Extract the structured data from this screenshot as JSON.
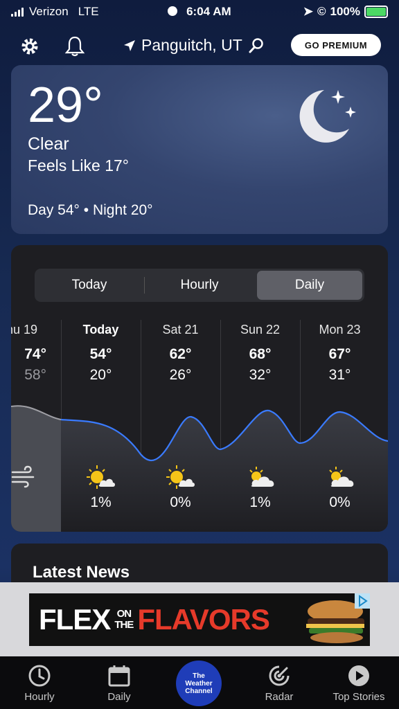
{
  "status_bar": {
    "carrier": "Verizon",
    "network": "LTE",
    "time": "6:04 AM",
    "battery": "100%"
  },
  "header": {
    "location": "Panguitch, UT",
    "premium_label": "GO PREMIUM"
  },
  "current": {
    "temperature": "29°",
    "condition": "Clear",
    "feels_like": "Feels Like 17°",
    "day_night": "Day 54° • Night 20°",
    "icon": "moon-stars-icon"
  },
  "forecast": {
    "tabs": [
      "Today",
      "Hourly",
      "Daily"
    ],
    "active_tab": "Daily",
    "days": [
      {
        "label": "hu 19",
        "high": "74°",
        "low": "58°",
        "precip": "",
        "icon": "wind-icon"
      },
      {
        "label": "Today",
        "high": "54°",
        "low": "20°",
        "precip": "1%",
        "icon": "sunny-cloud-icon"
      },
      {
        "label": "Sat 21",
        "high": "62°",
        "low": "26°",
        "precip": "0%",
        "icon": "sunny-cloud-icon"
      },
      {
        "label": "Sun 22",
        "high": "68°",
        "low": "32°",
        "precip": "1%",
        "icon": "partly-cloudy-icon"
      },
      {
        "label": "Mon 23",
        "high": "67°",
        "low": "31°",
        "precip": "0%",
        "icon": "partly-cloudy-icon"
      }
    ]
  },
  "news": {
    "title": "Latest News"
  },
  "ad": {
    "word1": "FLEX",
    "word2_top": "ON",
    "word2_bottom": "THE",
    "word3": "FLAVORS"
  },
  "tab_bar": {
    "hourly": "Hourly",
    "daily": "Daily",
    "brand_line1": "The",
    "brand_line2": "Weather",
    "brand_line3": "Channel",
    "radar": "Radar",
    "top_stories": "Top Stories"
  },
  "colors": {
    "accent_line": "#3a7bff",
    "premium_bg": "#ffffff",
    "brand_blue": "#1f3db8",
    "battery_green": "#4cd964"
  }
}
